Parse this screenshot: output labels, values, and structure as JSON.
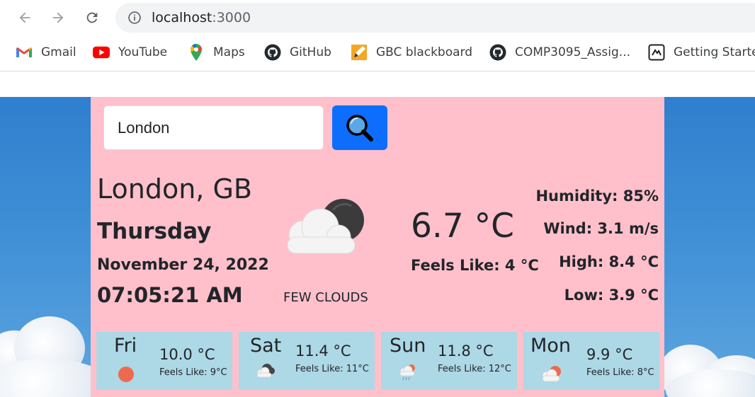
{
  "browser": {
    "url_host": "localhost",
    "url_port": ":3000",
    "bookmarks": [
      {
        "label": "Gmail",
        "icon": "gmail-icon"
      },
      {
        "label": "YouTube",
        "icon": "youtube-icon"
      },
      {
        "label": "Maps",
        "icon": "maps-icon"
      },
      {
        "label": "GitHub",
        "icon": "github-icon"
      },
      {
        "label": "GBC blackboard",
        "icon": "blackboard-icon"
      },
      {
        "label": "COMP3095_Assig...",
        "icon": "github-icon"
      },
      {
        "label": "Getting Starte",
        "icon": "getting-started-icon"
      }
    ]
  },
  "search": {
    "value": "London"
  },
  "current": {
    "city": "London, GB",
    "day": "Thursday",
    "date": "November 24, 2022",
    "time": "07:05:21 AM",
    "description": "FEW CLOUDS",
    "icon": "few-clouds-night-icon",
    "temperature": "6.7 °C",
    "feels_like": "Feels Like: 4 °C",
    "humidity": "Humidity: 85%",
    "wind": "Wind: 3.1 m/s",
    "high": "High: 8.4 °C",
    "low": "Low: 3.9 °C"
  },
  "forecast": [
    {
      "day": "Fri",
      "temp": "10.0 °C",
      "feels": "Feels Like: 9°C",
      "icon": "sun-icon"
    },
    {
      "day": "Sat",
      "temp": "11.4 °C",
      "feels": "Feels Like: 11°C",
      "icon": "dark-clouds-icon"
    },
    {
      "day": "Sun",
      "temp": "11.8 °C",
      "feels": "Feels Like: 12°C",
      "icon": "rain-cloud-icon"
    },
    {
      "day": "Mon",
      "temp": "9.9 °C",
      "feels": "Feels Like: 8°C",
      "icon": "sun-cloud-icon"
    }
  ],
  "colors": {
    "card": "#ffc0cb",
    "forecast_card": "#add8e6",
    "search_button": "#0d6efd",
    "sky": "#3f8fd6"
  }
}
